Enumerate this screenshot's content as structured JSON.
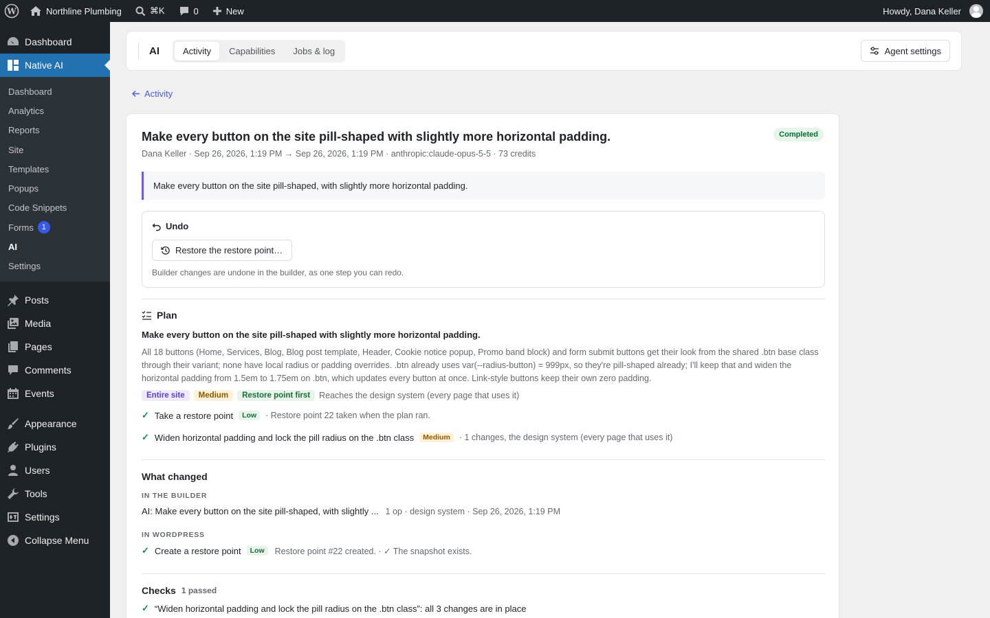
{
  "adminbar": {
    "site_name": "Northline Plumbing",
    "search_shortcut": "⌘K",
    "comments_count": "0",
    "new_label": "New",
    "greeting": "Howdy, Dana Keller"
  },
  "sidebar": {
    "dashboard": "Dashboard",
    "native_ai": "Native AI",
    "submenu": [
      {
        "label": "Dashboard"
      },
      {
        "label": "Analytics"
      },
      {
        "label": "Reports"
      },
      {
        "label": "Site"
      },
      {
        "label": "Templates"
      },
      {
        "label": "Popups"
      },
      {
        "label": "Code Snippets"
      },
      {
        "label": "Forms",
        "badge": "1"
      },
      {
        "label": "AI"
      },
      {
        "label": "Settings"
      }
    ],
    "menu": [
      {
        "label": "Posts",
        "icon": "pin-icon"
      },
      {
        "label": "Media",
        "icon": "media-icon"
      },
      {
        "label": "Pages",
        "icon": "pages-icon"
      },
      {
        "label": "Comments",
        "icon": "comment-icon"
      },
      {
        "label": "Events",
        "icon": "calendar-icon"
      },
      {
        "label": "Appearance",
        "icon": "brush-icon"
      },
      {
        "label": "Plugins",
        "icon": "plug-icon"
      },
      {
        "label": "Users",
        "icon": "user-icon"
      },
      {
        "label": "Tools",
        "icon": "wrench-icon"
      },
      {
        "label": "Settings",
        "icon": "settings-icon"
      },
      {
        "label": "Collapse Menu",
        "icon": "collapse-icon"
      }
    ]
  },
  "topbar": {
    "section": "AI",
    "tabs": [
      "Activity",
      "Capabilities",
      "Jobs & log"
    ],
    "agent_settings": "Agent settings"
  },
  "back_label": "Activity",
  "job": {
    "title": "Make every button on the site pill-shaped with slightly more horizontal padding.",
    "status": "Completed",
    "meta": "Dana Keller · Sep 26, 2026, 1:19 PM → Sep 26, 2026, 1:19 PM · anthropic:claude-opus-5-5 · 73 credits",
    "prompt": "Make every button on the site pill-shaped, with slightly more horizontal padding."
  },
  "undo": {
    "heading": "Undo",
    "button": "Restore the restore point…",
    "note": "Builder changes are undone in the builder, as one step you can redo."
  },
  "plan": {
    "heading": "Plan",
    "title": "Make every button on the site pill-shaped with slightly more horizontal padding.",
    "body": "All 18 buttons (Home, Services, Blog, Blog post template, Header, Cookie notice popup, Promo band block) and form submit buttons get their look from the shared .btn base class through their variant; none have local radius or padding overrides. .btn already uses var(--radius-button) = 999px, so they're pill-shaped already; I'll keep that and widen the horizontal padding from 1.5em to 1.75em on .btn, which updates every button at once. Link-style buttons keep their own zero padding.",
    "tags": [
      "Entire site",
      "Medium",
      "Restore point first"
    ],
    "scope": "Reaches the design system (every page that uses it)",
    "steps": [
      {
        "label": "Take a restore point",
        "level": "Low",
        "detail": "· Restore point 22 taken when the plan ran."
      },
      {
        "label": "Widen horizontal padding and lock the pill radius on the .btn class",
        "level": "Medium",
        "detail": "· 1 changes, the design system (every page that uses it)"
      }
    ]
  },
  "changes": {
    "heading": "What changed",
    "builder_label": "IN THE BUILDER",
    "builder_item": "AI: Make every button on the site pill-shaped, with slightly ...",
    "builder_meta": "1 op · design system · Sep 26, 2026, 1:19 PM",
    "wp_label": "IN WORDPRESS",
    "wp_item": "Create a restore point",
    "wp_level": "Low",
    "wp_meta": "Restore point #22 created. · ✓ The snapshot exists."
  },
  "checks": {
    "heading": "Checks",
    "summary": "1 passed",
    "items": [
      "“Widen horizontal padding and lock the pill radius on the .btn class”: all 3 changes are in place"
    ]
  }
}
